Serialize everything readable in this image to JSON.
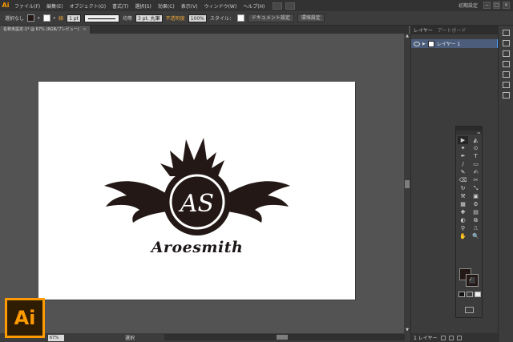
{
  "app": {
    "logo": "Ai",
    "menu": [
      "ファイル(F)",
      "編集(E)",
      "オブジェクト(O)",
      "書式(T)",
      "選択(S)",
      "効果(C)",
      "表示(V)",
      "ウィンドウ(W)",
      "ヘルプ(H)"
    ],
    "workspace": "初期設定",
    "window_controls": [
      "−",
      "□",
      "✕"
    ]
  },
  "control_bar": {
    "selection": "選択なし",
    "stroke_label": "線",
    "stroke_weight": "1 pt",
    "stroke_profile": "均等",
    "brush": "3 pt. 丸筆",
    "opacity_label": "不透明度",
    "opacity_value": "100%",
    "style_label": "スタイル：",
    "doc_settings": "ドキュメント設定",
    "prefs": "環境設定",
    "fill_color": "#231815",
    "stroke_color": "#ffffff"
  },
  "document": {
    "tab_title": "名称未設定-1* @ 67% (RGB/プレビュー)",
    "tab_close": "×",
    "artwork": {
      "initials": "AS",
      "brand": "Aroesmith",
      "ink_color": "#231815"
    }
  },
  "status_bar": {
    "zoom": "67%",
    "status": "選択"
  },
  "layers_panel": {
    "tabs": [
      "レイヤー",
      "アートボード"
    ],
    "layers": [
      {
        "name": "レイヤー 1",
        "color": "#4aa2ff"
      }
    ],
    "footer": "1 レイヤー"
  },
  "toolbox": {
    "tools": [
      "▶",
      "◭",
      "✦",
      "⊙",
      "✒",
      "T",
      "/",
      "▭",
      "✎",
      "✍",
      "⌫",
      "✂",
      "↻",
      "⤡",
      "⚒",
      "▣",
      "▦",
      "⚙",
      "✚",
      "▤",
      "◐",
      "⧉",
      "⚲",
      "⎍",
      "✋",
      "🔍"
    ],
    "fill_color": "#231815",
    "stroke_color": "#231815"
  },
  "badge": {
    "text": "Ai",
    "color": "#ff9a00"
  }
}
